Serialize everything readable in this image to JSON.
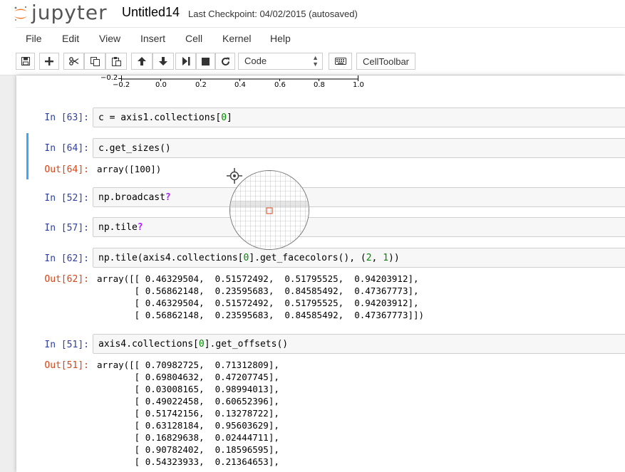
{
  "app": {
    "logo_text": "jupyter",
    "notebook_name": "Untitled14",
    "checkpoint": "Last Checkpoint: 04/02/2015 (autosaved)"
  },
  "menu": [
    "File",
    "Edit",
    "View",
    "Insert",
    "Cell",
    "Kernel",
    "Help"
  ],
  "toolbar": {
    "cell_type": "Code",
    "celltoolbar_label": "CellToolbar",
    "buttons": [
      "save-icon",
      "plus-icon",
      "scissors-icon",
      "copy-icon",
      "paste-icon",
      "arrow-up-icon",
      "arrow-down-icon",
      "step-forward-icon",
      "stop-icon",
      "restart-icon",
      "keyboard-icon"
    ]
  },
  "plot_fragment": {
    "y_tick": "−0.2",
    "x_ticks": [
      "−0.2",
      "0.0",
      "0.2",
      "0.4",
      "0.6",
      "0.8",
      "1.0"
    ]
  },
  "cells": [
    {
      "in_prompt": "In [63]:",
      "code_pre": "c = axis1.collections[",
      "code_num": "0",
      "code_post": "]"
    },
    {
      "in_prompt": "In [64]:",
      "code": "c.get_sizes()",
      "out_prompt": "Out[64]:",
      "output": "array([100])"
    },
    {
      "in_prompt": "In [52]:",
      "code": "np.broadcast",
      "qmark": "?"
    },
    {
      "in_prompt": "In [57]:",
      "code": "np.tile",
      "qmark": "?"
    },
    {
      "in_prompt": "In [62]:",
      "code_a": "np.tile(axis4.collections[",
      "code_n1": "0",
      "code_b": "].get_facecolors(), (",
      "code_n2": "2",
      "code_c": ", ",
      "code_n3": "1",
      "code_d": "))",
      "out_prompt": "Out[62]:",
      "output": "array([[ 0.46329504,  0.51572492,  0.51795525,  0.94203912],\n       [ 0.56862148,  0.23595683,  0.84585492,  0.47367773],\n       [ 0.46329504,  0.51572492,  0.51795525,  0.94203912],\n       [ 0.56862148,  0.23595683,  0.84585492,  0.47367773]])"
    },
    {
      "in_prompt": "In [51]:",
      "code_pre": "axis4.collections[",
      "code_num": "0",
      "code_post": "].get_offsets()",
      "out_prompt": "Out[51]:",
      "output": "array([[ 0.70982725,  0.71312809],\n       [ 0.69804632,  0.47207745],\n       [ 0.03008165,  0.98994013],\n       [ 0.49022458,  0.60652396],\n       [ 0.51742156,  0.13278722],\n       [ 0.63128184,  0.95603629],\n       [ 0.16829638,  0.02444711],\n       [ 0.90782402,  0.18596595],\n       [ 0.54323933,  0.21364653],"
    }
  ],
  "colors": {
    "in_prompt": "#303f9f",
    "out_prompt": "#d84315",
    "number": "#008800",
    "help_qmark": "#aa22ff",
    "selected_cell_bar": "#42a5f5",
    "logo_orange": "#f37726"
  }
}
